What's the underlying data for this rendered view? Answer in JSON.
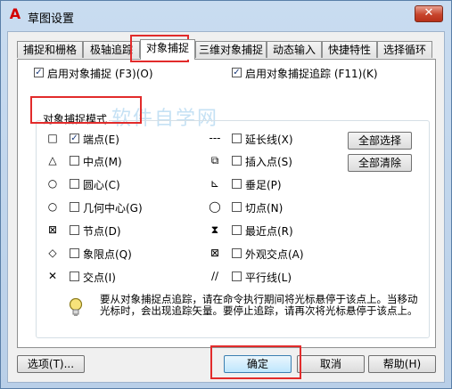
{
  "window": {
    "title": "草图设置",
    "app_icon": "autocad-icon"
  },
  "tabs": [
    {
      "label": "捕捉和栅格"
    },
    {
      "label": "极轴追踪"
    },
    {
      "label": "对象捕捉",
      "active": true
    },
    {
      "label": "三维对象捕捉"
    },
    {
      "label": "动态输入"
    },
    {
      "label": "快捷特性"
    },
    {
      "label": "选择循环"
    }
  ],
  "top_options": {
    "snap_on": {
      "label": "启用对象捕捉 (F3)(O)",
      "checked": true
    },
    "tracking_on": {
      "label": "启用对象捕捉追踪 (F11)(K)",
      "checked": true
    }
  },
  "group_title": "对象捕捉模式",
  "snap_modes_left": [
    {
      "symbol": "□",
      "label": "端点(E)",
      "checked": true
    },
    {
      "symbol": "△",
      "label": "中点(M)",
      "checked": false
    },
    {
      "symbol": "○",
      "label": "圆心(C)",
      "checked": false
    },
    {
      "symbol": "○",
      "label": "几何中心(G)",
      "checked": false
    },
    {
      "symbol": "⊠",
      "label": "节点(D)",
      "checked": false
    },
    {
      "symbol": "◇",
      "label": "象限点(Q)",
      "checked": false
    },
    {
      "symbol": "✕",
      "label": "交点(I)",
      "checked": false
    }
  ],
  "snap_modes_right": [
    {
      "symbol": "---",
      "label": "延长线(X)",
      "checked": false
    },
    {
      "symbol": "⧉",
      "label": "插入点(S)",
      "checked": false
    },
    {
      "symbol": "⊾",
      "label": "垂足(P)",
      "checked": false
    },
    {
      "symbol": "◯",
      "label": "切点(N)",
      "checked": false
    },
    {
      "symbol": "⧗",
      "label": "最近点(R)",
      "checked": false
    },
    {
      "symbol": "⊠",
      "label": "外观交点(A)",
      "checked": false
    },
    {
      "symbol": "∕∕",
      "label": "平行线(L)",
      "checked": false
    }
  ],
  "side_buttons": {
    "select_all": "全部选择",
    "clear_all": "全部清除"
  },
  "note": "要从对象捕捉点追踪，请在命令执行期间将光标悬停于该点上。当移动光标时，会出现追踪矢量。要停止追踪，请再次将光标悬停于该点上。",
  "watermark": "软件自学网",
  "footer": {
    "options": "选项(T)...",
    "ok": "确定",
    "cancel": "取消",
    "help": "帮助(H)"
  },
  "colors": {
    "highlight": "#e22b2b",
    "title_bar": "#c9dcf0",
    "check": "#1a3a7a"
  }
}
